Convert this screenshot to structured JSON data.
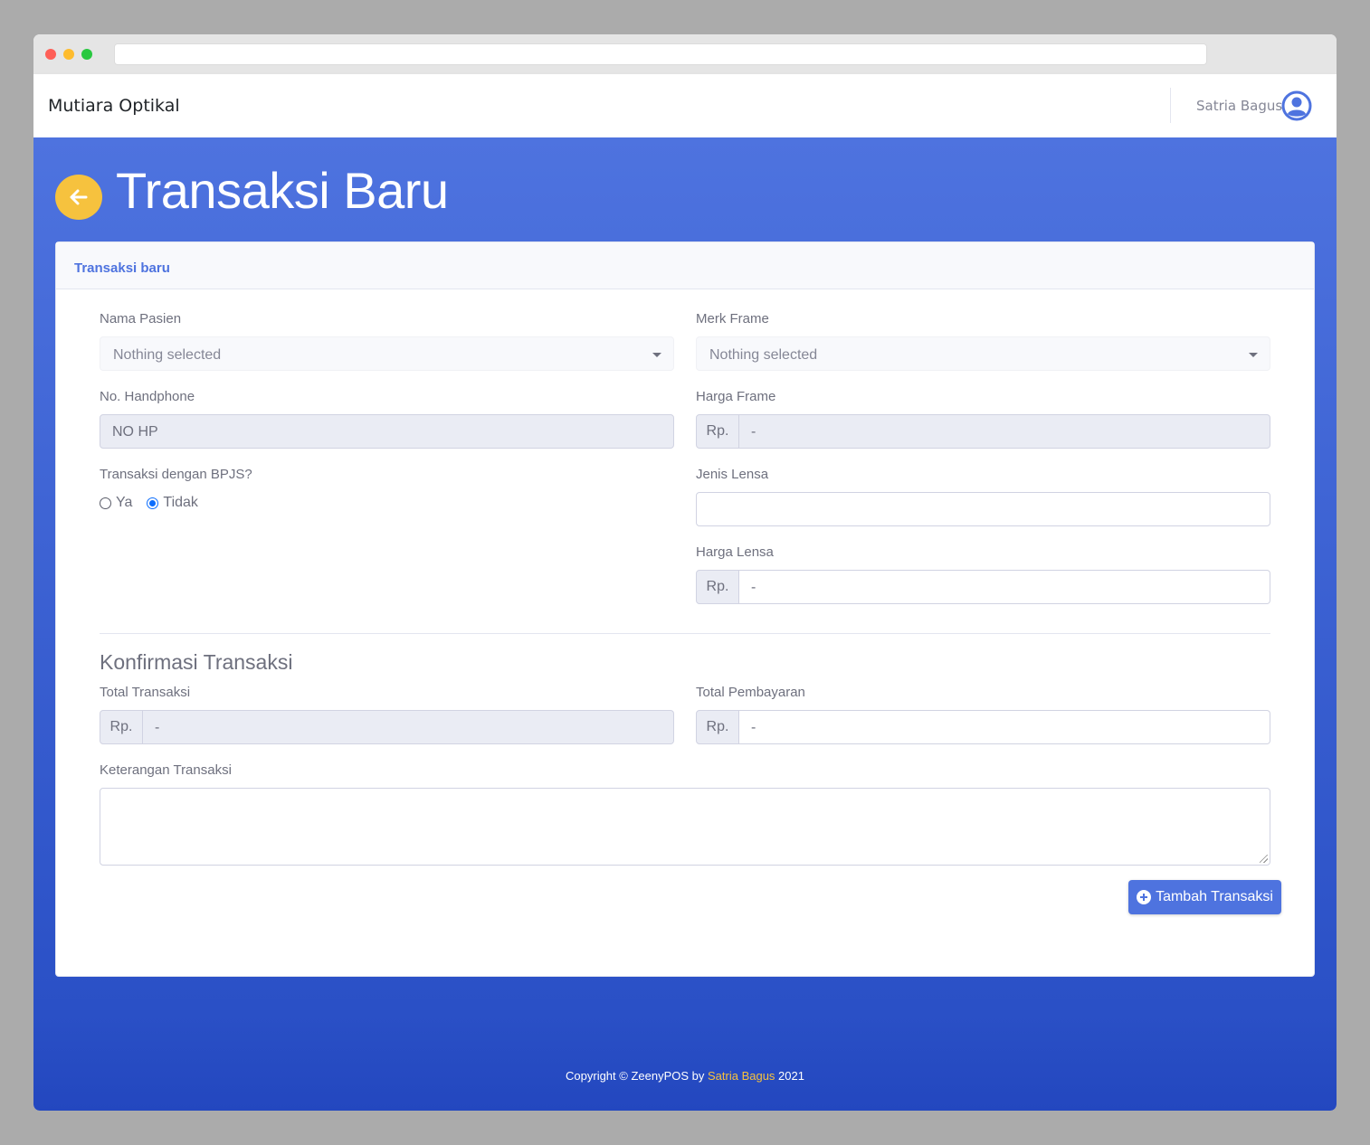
{
  "app": {
    "brand": "Mutiara Optikal"
  },
  "user": {
    "name": "Satria Bagus"
  },
  "page": {
    "title": "Transaksi Baru"
  },
  "card": {
    "header": "Transaksi baru"
  },
  "form": {
    "nama_pasien": {
      "label": "Nama Pasien",
      "value": "Nothing selected"
    },
    "merk_frame": {
      "label": "Merk Frame",
      "value": "Nothing selected"
    },
    "no_handphone": {
      "label": "No. Handphone",
      "value": "NO HP"
    },
    "harga_frame": {
      "label": "Harga Frame",
      "prefix": "Rp.",
      "value": "-"
    },
    "bpjs": {
      "label": "Transaksi dengan BPJS?",
      "options": [
        "Ya",
        "Tidak"
      ],
      "selected": "Tidak"
    },
    "jenis_lensa": {
      "label": "Jenis Lensa",
      "value": ""
    },
    "harga_lensa": {
      "label": "Harga Lensa",
      "prefix": "Rp.",
      "value": "-"
    }
  },
  "konfirmasi": {
    "title": "Konfirmasi Transaksi",
    "total_transaksi": {
      "label": "Total Transaksi",
      "prefix": "Rp.",
      "value": "-"
    },
    "total_pembayaran": {
      "label": "Total Pembayaran",
      "prefix": "Rp.",
      "value": "-"
    },
    "keterangan": {
      "label": "Keterangan Transaksi",
      "value": ""
    },
    "submit_label": "Tambah Transaksi"
  },
  "footer": {
    "prefix": "Copyright © ZeenyPOS by ",
    "author": "Satria Bagus",
    "suffix": " 2021"
  },
  "colors": {
    "primary": "#4e73df",
    "warning": "#f6c23e"
  }
}
